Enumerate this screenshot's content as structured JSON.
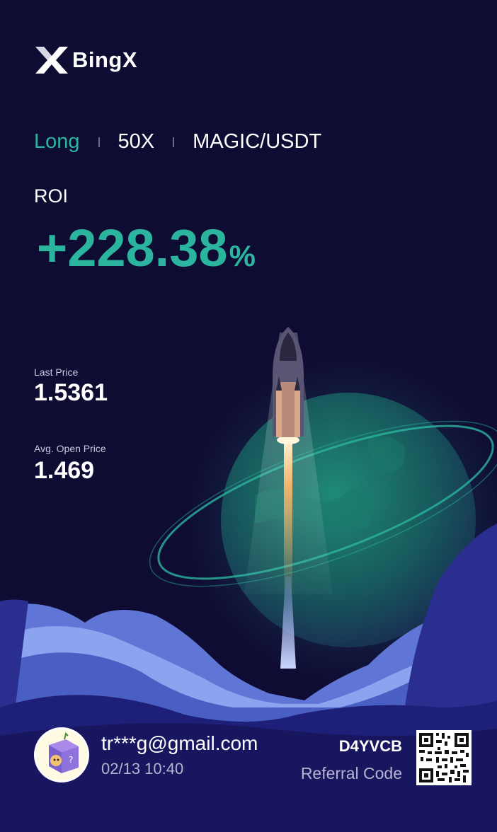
{
  "brand": {
    "name": "BingX"
  },
  "position": {
    "side": "Long",
    "leverage": "50X",
    "pair": "MAGIC/USDT"
  },
  "roi": {
    "label": "ROI",
    "value": "+228.38",
    "unit": "%"
  },
  "stats": {
    "last_price_label": "Last Price",
    "last_price": "1.5361",
    "avg_open_label": "Avg. Open Price",
    "avg_open": "1.469"
  },
  "user": {
    "email": "tr***g@gmail.com",
    "timestamp": "02/13 10:40"
  },
  "referral": {
    "code": "D4YVCB",
    "label": "Referral Code"
  },
  "colors": {
    "background": "#0f0c33",
    "accent": "#2bb59f",
    "cloud": "#6f86e0"
  }
}
